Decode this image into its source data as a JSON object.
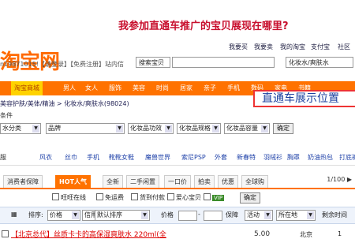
{
  "banner": {
    "question": "我参加直通车推广的宝贝展现在哪里?"
  },
  "header": {
    "logo": "淘宝网",
    "links": [
      "我要买",
      "我要卖",
      "我的淘宝",
      "支付宝",
      "社区"
    ],
    "user_line": "n19871015!【请登录】【免费注册】站内信",
    "search_type": "搜索宝贝",
    "search_keyword": "化妆水/爽肤水"
  },
  "nav": {
    "items": [
      "淘宝商城",
      "男人",
      "女人",
      "服饰",
      "美容",
      "时尚",
      "居家",
      "亲子",
      "手机",
      "数码",
      "家电",
      "书籍"
    ]
  },
  "breadcrumb": "美容护肤/美体/精油 > 化妆水/爽肤水(98024)",
  "side_label": "条件",
  "callout": "直通车展示位置",
  "filters": {
    "category_label": "水分类",
    "brand": "品牌",
    "effect": "化妆品功效",
    "spec": "化妆品规格",
    "capacity": "化妆品容量",
    "confirm": "确定"
  },
  "categories": {
    "label": "服",
    "items": [
      "风衣",
      "丝巾",
      "手机",
      "靴靴女鞋",
      "魔兽世界",
      "索尼PSP",
      "外套",
      "新春特",
      "羽绒衫",
      "胸罩",
      "奶油热包",
      "打底裤"
    ]
  },
  "tabs": {
    "items": [
      "消费者保障",
      "HOT人气",
      "全新",
      "二手闲置",
      "一口价",
      "拍卖",
      "优惠",
      "全球购"
    ],
    "active_index": 1,
    "page_info": "1/100",
    "next_icon": "next-page-icon"
  },
  "checks": {
    "items": [
      "旺旺在线",
      "免运费",
      "货到付款",
      "爱心宝贝",
      "合作卖家"
    ],
    "confirm": "确定",
    "vip_badge": "VIP"
  },
  "sort": {
    "label": "排序:",
    "price_select": "价格",
    "credit_select": "信用",
    "default_sort": "默认排序",
    "price_label": "价格",
    "to": "-",
    "warranty": "保障",
    "activity": "活动",
    "location": "所在地",
    "remaining": "剩余时间"
  },
  "results": [
    {
      "title": "【北京总代】丝质卡卡的高保湿爽肤水 220ml(全",
      "price": "5.00",
      "location": "北京",
      "badge": "1"
    }
  ],
  "colors": {
    "brand_orange": "#ff7200",
    "callout_border": "#e33333",
    "callout_text": "#1b3f9e",
    "banner_red": "#c8102e"
  }
}
